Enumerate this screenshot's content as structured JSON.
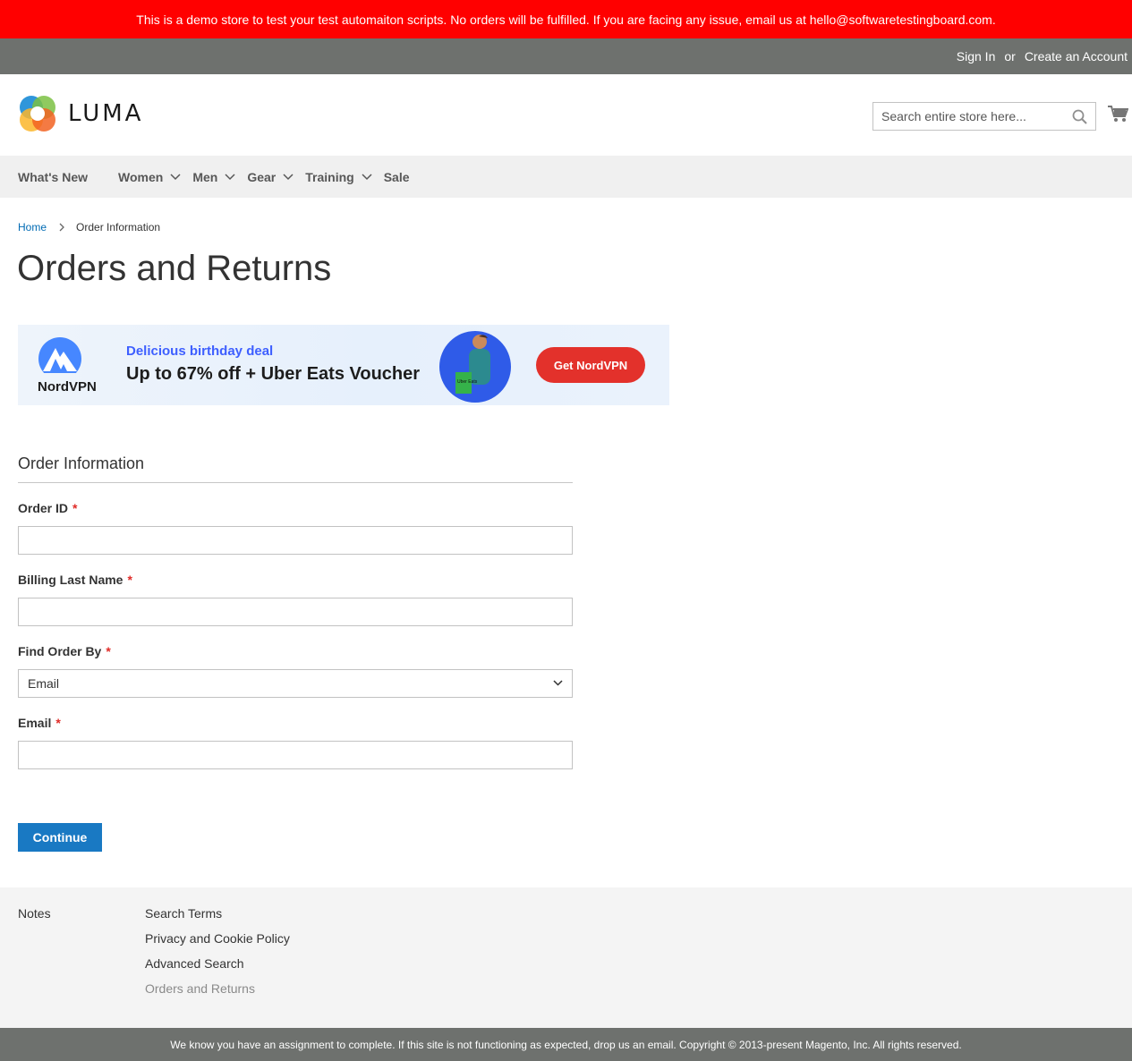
{
  "demo_banner": "This is a demo store to test your test automaiton scripts. No orders will be fulfilled. If you are facing any issue, email us at hello@softwaretestingboard.com.",
  "topbar": {
    "sign_in": "Sign In",
    "or": "or",
    "create_account": "Create an Account"
  },
  "header": {
    "logo_text": "LUMA",
    "search_placeholder": "Search entire store here...",
    "search_icon": "magnifier-icon",
    "cart_icon": "cart-icon"
  },
  "nav": {
    "items": [
      {
        "label": "What's New",
        "has_dropdown": false
      },
      {
        "label": "Women",
        "has_dropdown": true
      },
      {
        "label": "Men",
        "has_dropdown": true
      },
      {
        "label": "Gear",
        "has_dropdown": true
      },
      {
        "label": "Training",
        "has_dropdown": true
      },
      {
        "label": "Sale",
        "has_dropdown": false
      }
    ]
  },
  "breadcrumb": {
    "home": "Home",
    "current": "Order Information"
  },
  "page_title": "Orders and Returns",
  "ad": {
    "brand": "NordVPN",
    "subtitle": "Delicious birthday deal",
    "headline": "Up to 67% off + Uber Eats Voucher",
    "cta": "Get NordVPN",
    "image_text": "Uber Eats"
  },
  "form": {
    "legend": "Order Information",
    "fields": [
      {
        "label": "Order ID",
        "required_mark": "*",
        "value": ""
      },
      {
        "label": "Billing Last Name",
        "required_mark": "*",
        "value": ""
      },
      {
        "label": "Find Order By",
        "required_mark": "*",
        "value": "Email"
      },
      {
        "label": "Email",
        "required_mark": "*",
        "value": ""
      }
    ],
    "submit": "Continue"
  },
  "footer": {
    "notes": "Notes",
    "links": [
      "Search Terms",
      "Privacy and Cookie Policy",
      "Advanced Search",
      "Orders and Returns"
    ]
  },
  "copyright": "We know you have an assignment to complete. If this site is not functioning as expected, drop us an email. Copyright © 2013-present Magento, Inc. All rights reserved.",
  "colors": {
    "banner_red": "#ff0000",
    "topbar_gray": "#6e716e",
    "link_blue": "#006bb4",
    "button_blue": "#1979c3",
    "required_red": "#e02b27",
    "ad_cta_red": "#e3312b",
    "ad_blue": "#3e5fff"
  }
}
